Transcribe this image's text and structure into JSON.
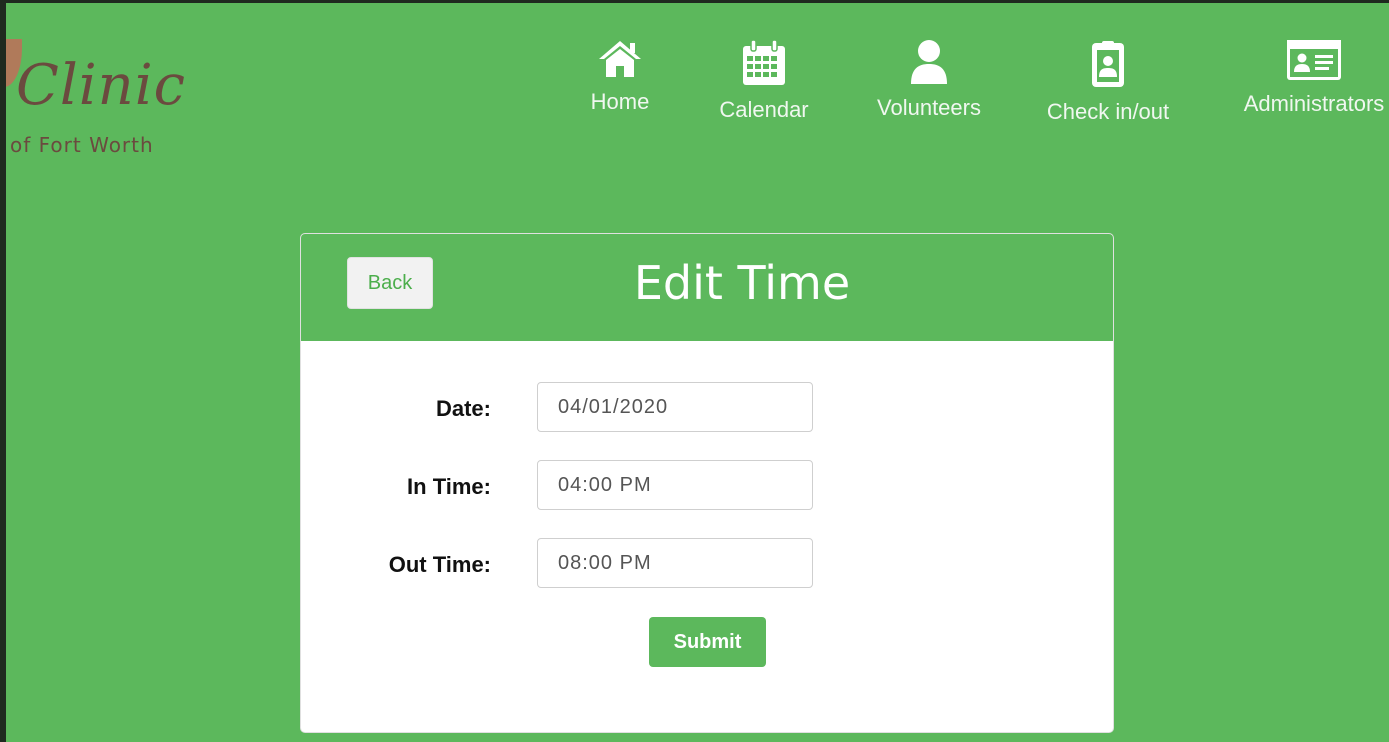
{
  "logo": {
    "name": "Clinic",
    "subtitle": "of Fort Worth"
  },
  "nav": {
    "items": [
      {
        "label": "Home",
        "icon": "home-icon"
      },
      {
        "label": "Calendar",
        "icon": "calendar-icon"
      },
      {
        "label": "Volunteers",
        "icon": "user-icon"
      },
      {
        "label": "Check in/out",
        "icon": "id-badge-icon"
      },
      {
        "label": "Administrators",
        "icon": "id-card-icon"
      }
    ]
  },
  "form": {
    "title": "Edit Time",
    "back_label": "Back",
    "date_label": "Date:",
    "date_value": "04/01/2020",
    "in_time_label": "In Time:",
    "in_time_value": "04:00 PM",
    "out_time_label": "Out Time:",
    "out_time_value": "08:00 PM",
    "submit_label": "Submit"
  },
  "colors": {
    "primary_green": "#5cb85c",
    "logo_brown": "#6b4a3f"
  }
}
